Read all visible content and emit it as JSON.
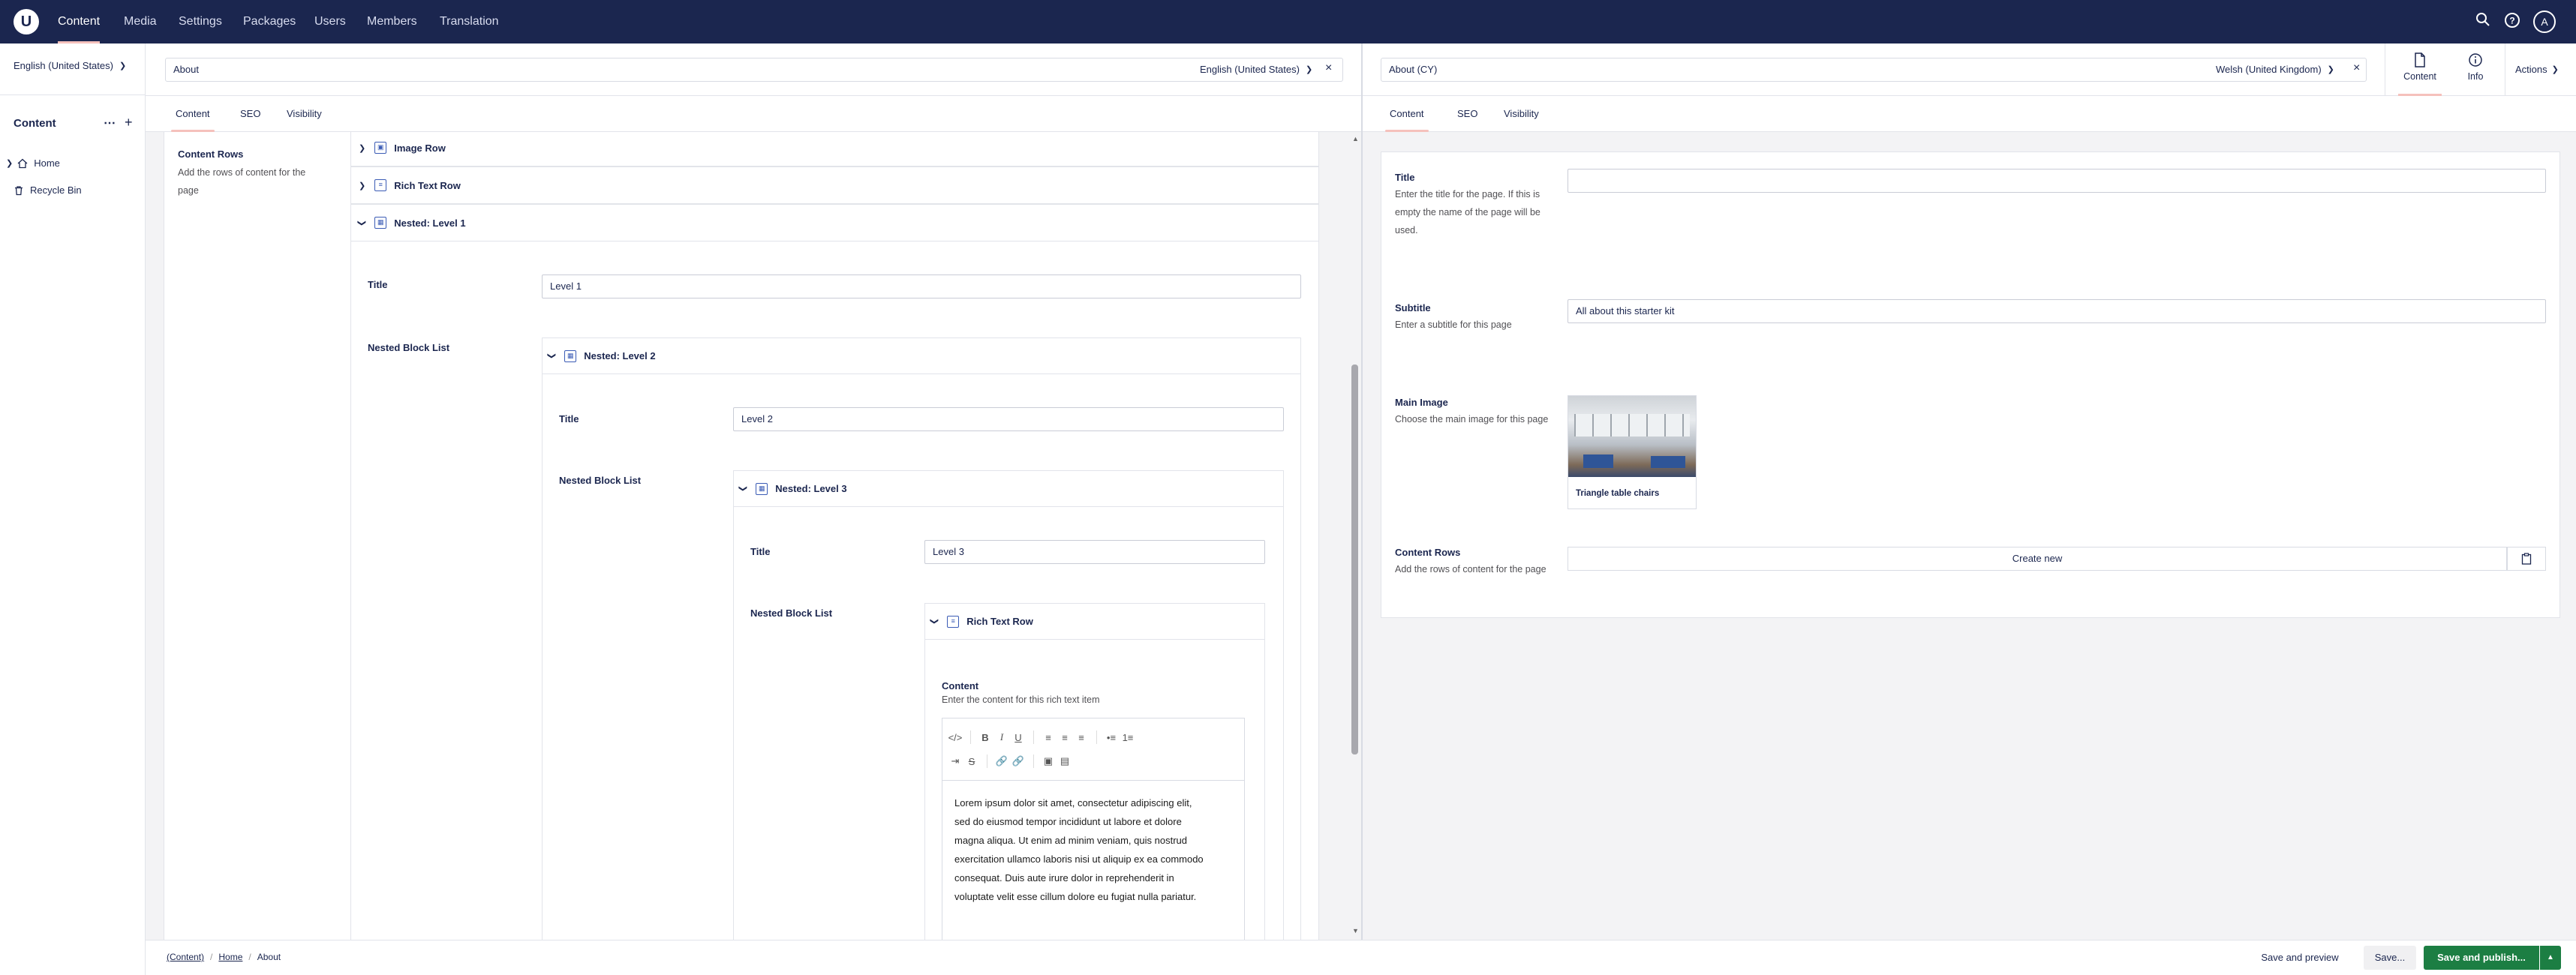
{
  "header": {
    "logo": "U",
    "nav": [
      "Content",
      "Media",
      "Settings",
      "Packages",
      "Users",
      "Members",
      "Translation"
    ],
    "active_nav": "Content",
    "icons": [
      "search-icon",
      "help-icon"
    ],
    "avatar": "A"
  },
  "sidebar": {
    "culture": "English (United States)",
    "section_title": "Content",
    "tree": [
      {
        "label": "Home",
        "icon": "home-icon"
      },
      {
        "label": "Recycle Bin",
        "icon": "trash-icon"
      }
    ]
  },
  "left_pane": {
    "name": "About",
    "culture": "English (United States)",
    "tabs": [
      "Content",
      "SEO",
      "Visibility"
    ],
    "content_rows": {
      "label": "Content Rows",
      "description": "Add the rows of content for the page"
    },
    "rows": [
      "Image Row",
      "Rich Text Row"
    ],
    "nested1": {
      "header": "Nested: Level 1",
      "title_label": "Title",
      "title_value": "Level 1",
      "list_label": "Nested Block List"
    },
    "nested2": {
      "header": "Nested: Level 2",
      "title_label": "Title",
      "title_value": "Level 2",
      "list_label": "Nested Block List"
    },
    "nested3": {
      "header": "Nested: Level 3",
      "title_label": "Title",
      "title_value": "Level 3",
      "list_label": "Nested Block List"
    },
    "richtext": {
      "header": "Rich Text Row",
      "label": "Content",
      "description": "Enter the content for this rich text item",
      "lines": [
        "Lorem ipsum dolor sit amet, consectetur adipiscing elit,",
        "sed do eiusmod tempor incididunt ut labore et dolore",
        "magna aliqua. Ut enim ad minim veniam, quis nostrud",
        "exercitation ullamco laboris nisi ut aliquip ex ea commodo",
        "consequat. Duis aute irure dolor in reprehenderit in",
        "voluptate velit esse cillum dolore eu fugiat nulla pariatur."
      ]
    }
  },
  "right_pane": {
    "name": "About (CY)",
    "culture": "Welsh (United Kingdom)",
    "apps": [
      {
        "label": "Content",
        "icon": "document-icon"
      },
      {
        "label": "Info",
        "icon": "info-icon"
      }
    ],
    "actions": "Actions",
    "tabs": [
      "Content",
      "SEO",
      "Visibility"
    ],
    "title": {
      "label": "Title",
      "description": "Enter the title for the page. If this is empty the name of the page will be used.",
      "value": ""
    },
    "subtitle": {
      "label": "Subtitle",
      "description": "Enter a subtitle for this page",
      "value": "All about this starter kit"
    },
    "main_image": {
      "label": "Main Image",
      "description": "Choose the main image for this page",
      "caption": "Triangle table chairs"
    },
    "content_rows": {
      "label": "Content Rows",
      "description": "Add the rows of content for the page",
      "create_label": "Create new"
    }
  },
  "footer": {
    "breadcrumb": [
      "(Content)",
      "Home",
      "About"
    ],
    "save_preview": "Save and preview",
    "save": "Save...",
    "save_publish": "Save and publish..."
  },
  "colors": {
    "header_bg": "#1b264f",
    "accent_tab": "#f5c1bc",
    "publish_green": "#1c7e43"
  }
}
